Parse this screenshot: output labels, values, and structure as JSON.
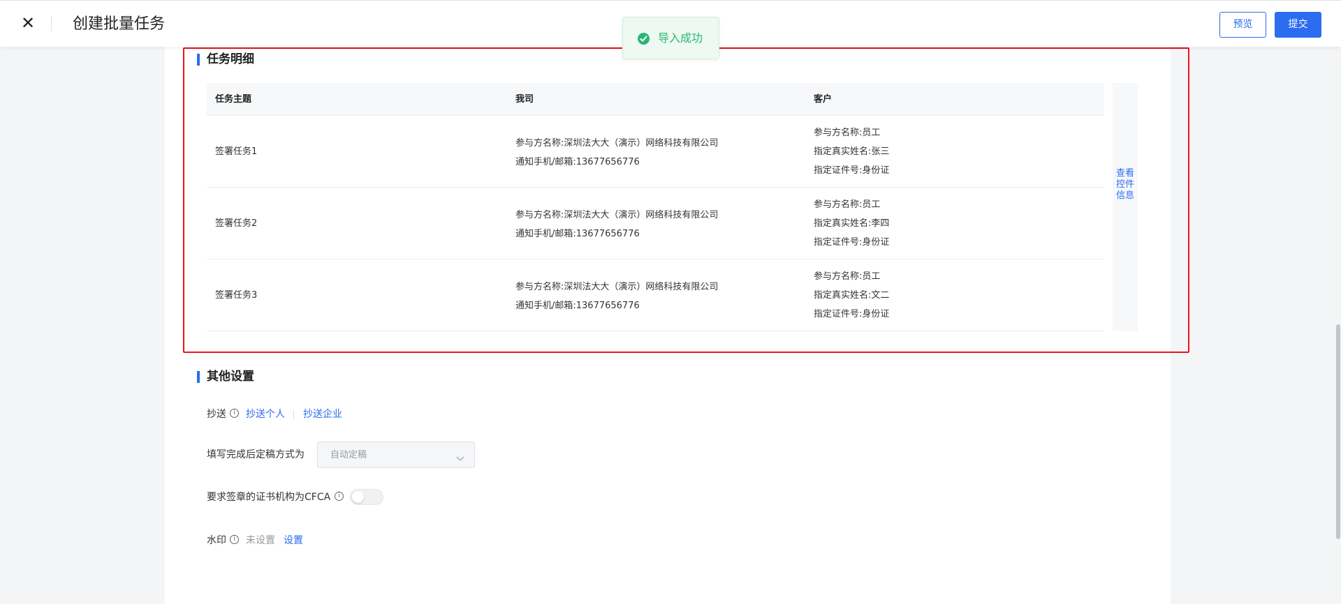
{
  "header": {
    "close_symbol": "✕",
    "title": "创建批量任务",
    "preview_label": "预览",
    "submit_label": "提交"
  },
  "toast": {
    "icon": "check-circle-icon",
    "message": "导入成功",
    "color": "#2bb673"
  },
  "task_detail": {
    "title": "任务明细",
    "columns": [
      "任务主题",
      "我司",
      "客户"
    ],
    "rows": [
      {
        "subject": "签署任务1",
        "mine": [
          "参与方名称:深圳法大大（演示）网络科技有限公司",
          "通知手机/邮箱:13677656776"
        ],
        "customer": [
          "参与方名称:员工",
          "指定真实姓名:张三",
          "指定证件号:身份证"
        ]
      },
      {
        "subject": "签署任务2",
        "mine": [
          "参与方名称:深圳法大大（演示）网络科技有限公司",
          "通知手机/邮箱:13677656776"
        ],
        "customer": [
          "参与方名称:员工",
          "指定真实姓名:李四",
          "指定证件号:身份证"
        ]
      },
      {
        "subject": "签署任务3",
        "mine": [
          "参与方名称:深圳法大大（演示）网络科技有限公司",
          "通知手机/邮箱:13677656776"
        ],
        "customer": [
          "参与方名称:员工",
          "指定真实姓名:文二",
          "指定证件号:身份证"
        ]
      }
    ],
    "side_link": "查看控件信息"
  },
  "other_settings": {
    "title": "其他设置",
    "cc_label": "抄送",
    "cc_personal": "抄送个人",
    "cc_enterprise": "抄送企业",
    "finalize_label": "填写完成后定稿方式为",
    "finalize_value": "自动定稿",
    "cfca_label": "要求签章的证书机构为CFCA",
    "cfca_enabled": false,
    "watermark_label": "水印",
    "watermark_status": "未设置",
    "watermark_action": "设置"
  },
  "colors": {
    "accent": "#2b6cf0",
    "highlight": "#e8141e",
    "success": "#2bb673"
  }
}
